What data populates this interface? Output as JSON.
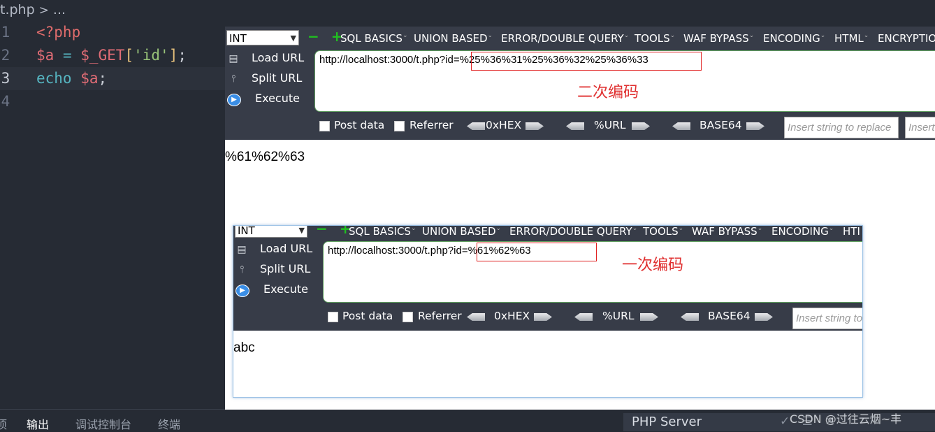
{
  "editor": {
    "breadcrumb": {
      "file": "t.php",
      "sep": ">",
      "rest": "..."
    },
    "lines": [
      {
        "num": "1",
        "tokens": [
          {
            "cls": "tk-tag",
            "text": "<?php"
          }
        ]
      },
      {
        "num": "2",
        "tokens": [
          {
            "cls": "tk-var",
            "text": "$a"
          },
          {
            "cls": "tk-op",
            "text": " = "
          },
          {
            "cls": "tk-var",
            "text": "$_GET"
          },
          {
            "cls": "tk-brk",
            "text": "["
          },
          {
            "cls": "tk-str",
            "text": "'id'"
          },
          {
            "cls": "tk-brk",
            "text": "]"
          },
          {
            "cls": "tk-punc",
            "text": ";"
          }
        ]
      },
      {
        "num": "3",
        "tokens": [
          {
            "cls": "tk-kw",
            "text": "echo"
          },
          {
            "cls": "tk-punc",
            "text": " "
          },
          {
            "cls": "tk-var",
            "text": "$a"
          },
          {
            "cls": "tk-punc",
            "text": ";"
          }
        ]
      },
      {
        "num": "4",
        "tokens": []
      }
    ],
    "bottom_tabs": [
      "项",
      "输出",
      "调试控制台",
      "终端"
    ],
    "active_tab": "输出",
    "status_label": "PHP Server",
    "status_icons": "✓ ☰ ✕"
  },
  "hackbar": {
    "select_value": "INT",
    "plusminus": "− +",
    "menus": [
      "SQL BASICS",
      "UNION BASED",
      "ERROR/DOUBLE QUERY",
      "TOOLS",
      "WAF BYPASS",
      "ENCODING",
      "HTML",
      "ENCRYPTION"
    ],
    "commands": {
      "load": "Load URL",
      "split": "Split URL",
      "execute": "Execute"
    },
    "options": {
      "post": "Post data",
      "referrer": "Referrer"
    },
    "encoders": {
      "hex": "0xHEX",
      "url": "%URL",
      "base64": "BASE64"
    },
    "insert_placeholder": "Insert string to replace",
    "insert_placeholder2": "Insert"
  },
  "panel1": {
    "url_prefix": "http://localhost:3000/t.php?id",
    "url_encoded": "=%25%36%31%25%36%32%25%36%33",
    "annotation": "二次编码",
    "output": "%61%62%63"
  },
  "panel2": {
    "url_prefix": "http://localhost:3000/t.php?id",
    "url_encoded": "=%61%62%63",
    "annotation": "一次编码",
    "output": "abc",
    "menus_visible": [
      "SQL BASICS",
      "UNION BASED",
      "ERROR/DOUBLE QUERY",
      "TOOLS",
      "WAF BYPASS",
      "ENCODING",
      "HTI"
    ]
  },
  "watermark": "CSDN @过往云烟~丰"
}
